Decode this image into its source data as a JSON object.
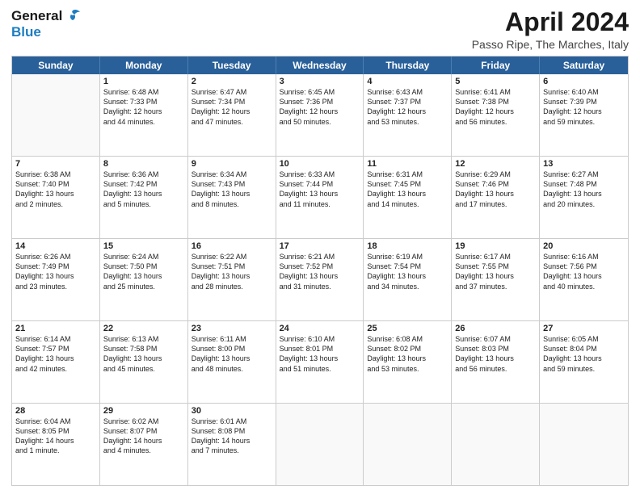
{
  "logo": {
    "general": "General",
    "blue": "Blue"
  },
  "header": {
    "title": "April 2024",
    "subtitle": "Passo Ripe, The Marches, Italy"
  },
  "days": [
    "Sunday",
    "Monday",
    "Tuesday",
    "Wednesday",
    "Thursday",
    "Friday",
    "Saturday"
  ],
  "weeks": [
    [
      {
        "day": "",
        "lines": []
      },
      {
        "day": "1",
        "lines": [
          "Sunrise: 6:48 AM",
          "Sunset: 7:33 PM",
          "Daylight: 12 hours",
          "and 44 minutes."
        ]
      },
      {
        "day": "2",
        "lines": [
          "Sunrise: 6:47 AM",
          "Sunset: 7:34 PM",
          "Daylight: 12 hours",
          "and 47 minutes."
        ]
      },
      {
        "day": "3",
        "lines": [
          "Sunrise: 6:45 AM",
          "Sunset: 7:36 PM",
          "Daylight: 12 hours",
          "and 50 minutes."
        ]
      },
      {
        "day": "4",
        "lines": [
          "Sunrise: 6:43 AM",
          "Sunset: 7:37 PM",
          "Daylight: 12 hours",
          "and 53 minutes."
        ]
      },
      {
        "day": "5",
        "lines": [
          "Sunrise: 6:41 AM",
          "Sunset: 7:38 PM",
          "Daylight: 12 hours",
          "and 56 minutes."
        ]
      },
      {
        "day": "6",
        "lines": [
          "Sunrise: 6:40 AM",
          "Sunset: 7:39 PM",
          "Daylight: 12 hours",
          "and 59 minutes."
        ]
      }
    ],
    [
      {
        "day": "7",
        "lines": [
          "Sunrise: 6:38 AM",
          "Sunset: 7:40 PM",
          "Daylight: 13 hours",
          "and 2 minutes."
        ]
      },
      {
        "day": "8",
        "lines": [
          "Sunrise: 6:36 AM",
          "Sunset: 7:42 PM",
          "Daylight: 13 hours",
          "and 5 minutes."
        ]
      },
      {
        "day": "9",
        "lines": [
          "Sunrise: 6:34 AM",
          "Sunset: 7:43 PM",
          "Daylight: 13 hours",
          "and 8 minutes."
        ]
      },
      {
        "day": "10",
        "lines": [
          "Sunrise: 6:33 AM",
          "Sunset: 7:44 PM",
          "Daylight: 13 hours",
          "and 11 minutes."
        ]
      },
      {
        "day": "11",
        "lines": [
          "Sunrise: 6:31 AM",
          "Sunset: 7:45 PM",
          "Daylight: 13 hours",
          "and 14 minutes."
        ]
      },
      {
        "day": "12",
        "lines": [
          "Sunrise: 6:29 AM",
          "Sunset: 7:46 PM",
          "Daylight: 13 hours",
          "and 17 minutes."
        ]
      },
      {
        "day": "13",
        "lines": [
          "Sunrise: 6:27 AM",
          "Sunset: 7:48 PM",
          "Daylight: 13 hours",
          "and 20 minutes."
        ]
      }
    ],
    [
      {
        "day": "14",
        "lines": [
          "Sunrise: 6:26 AM",
          "Sunset: 7:49 PM",
          "Daylight: 13 hours",
          "and 23 minutes."
        ]
      },
      {
        "day": "15",
        "lines": [
          "Sunrise: 6:24 AM",
          "Sunset: 7:50 PM",
          "Daylight: 13 hours",
          "and 25 minutes."
        ]
      },
      {
        "day": "16",
        "lines": [
          "Sunrise: 6:22 AM",
          "Sunset: 7:51 PM",
          "Daylight: 13 hours",
          "and 28 minutes."
        ]
      },
      {
        "day": "17",
        "lines": [
          "Sunrise: 6:21 AM",
          "Sunset: 7:52 PM",
          "Daylight: 13 hours",
          "and 31 minutes."
        ]
      },
      {
        "day": "18",
        "lines": [
          "Sunrise: 6:19 AM",
          "Sunset: 7:54 PM",
          "Daylight: 13 hours",
          "and 34 minutes."
        ]
      },
      {
        "day": "19",
        "lines": [
          "Sunrise: 6:17 AM",
          "Sunset: 7:55 PM",
          "Daylight: 13 hours",
          "and 37 minutes."
        ]
      },
      {
        "day": "20",
        "lines": [
          "Sunrise: 6:16 AM",
          "Sunset: 7:56 PM",
          "Daylight: 13 hours",
          "and 40 minutes."
        ]
      }
    ],
    [
      {
        "day": "21",
        "lines": [
          "Sunrise: 6:14 AM",
          "Sunset: 7:57 PM",
          "Daylight: 13 hours",
          "and 42 minutes."
        ]
      },
      {
        "day": "22",
        "lines": [
          "Sunrise: 6:13 AM",
          "Sunset: 7:58 PM",
          "Daylight: 13 hours",
          "and 45 minutes."
        ]
      },
      {
        "day": "23",
        "lines": [
          "Sunrise: 6:11 AM",
          "Sunset: 8:00 PM",
          "Daylight: 13 hours",
          "and 48 minutes."
        ]
      },
      {
        "day": "24",
        "lines": [
          "Sunrise: 6:10 AM",
          "Sunset: 8:01 PM",
          "Daylight: 13 hours",
          "and 51 minutes."
        ]
      },
      {
        "day": "25",
        "lines": [
          "Sunrise: 6:08 AM",
          "Sunset: 8:02 PM",
          "Daylight: 13 hours",
          "and 53 minutes."
        ]
      },
      {
        "day": "26",
        "lines": [
          "Sunrise: 6:07 AM",
          "Sunset: 8:03 PM",
          "Daylight: 13 hours",
          "and 56 minutes."
        ]
      },
      {
        "day": "27",
        "lines": [
          "Sunrise: 6:05 AM",
          "Sunset: 8:04 PM",
          "Daylight: 13 hours",
          "and 59 minutes."
        ]
      }
    ],
    [
      {
        "day": "28",
        "lines": [
          "Sunrise: 6:04 AM",
          "Sunset: 8:05 PM",
          "Daylight: 14 hours",
          "and 1 minute."
        ]
      },
      {
        "day": "29",
        "lines": [
          "Sunrise: 6:02 AM",
          "Sunset: 8:07 PM",
          "Daylight: 14 hours",
          "and 4 minutes."
        ]
      },
      {
        "day": "30",
        "lines": [
          "Sunrise: 6:01 AM",
          "Sunset: 8:08 PM",
          "Daylight: 14 hours",
          "and 7 minutes."
        ]
      },
      {
        "day": "",
        "lines": []
      },
      {
        "day": "",
        "lines": []
      },
      {
        "day": "",
        "lines": []
      },
      {
        "day": "",
        "lines": []
      }
    ]
  ]
}
